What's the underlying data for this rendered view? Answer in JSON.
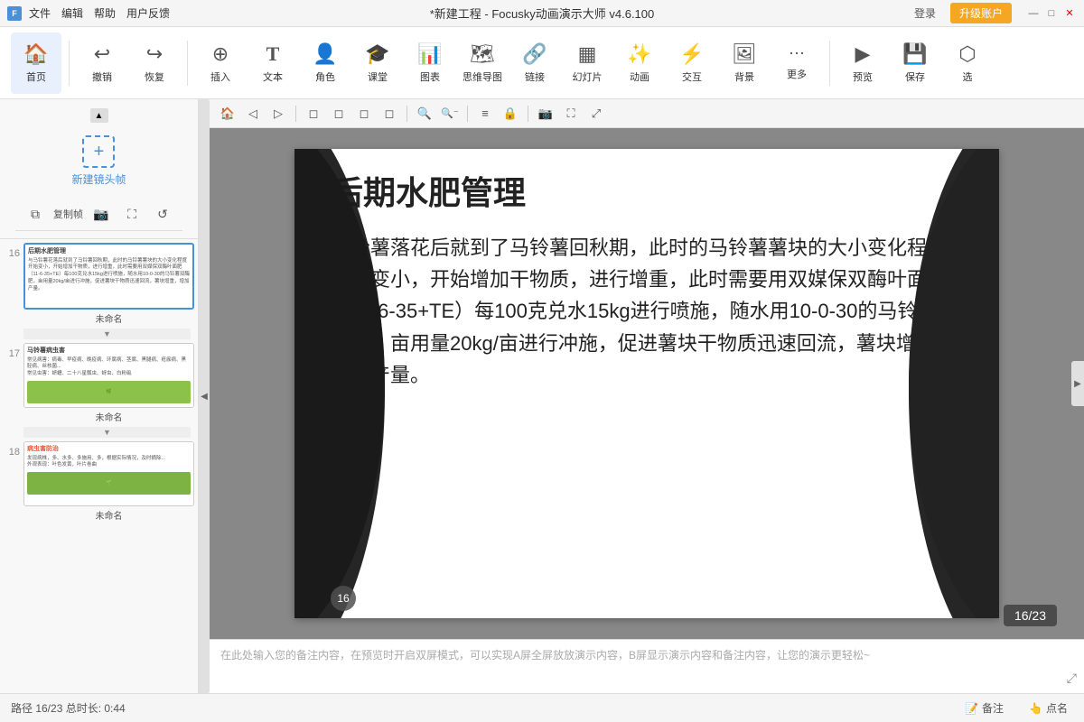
{
  "titlebar": {
    "logo": "F",
    "menu": [
      "文件",
      "编辑",
      "帮助",
      "用户反馈"
    ],
    "title": "*新建工程 - Focusky动画演示大师  v4.6.100",
    "login_label": "登录",
    "upgrade_label": "升级账户",
    "win_min": "—",
    "win_max": "□",
    "win_close": "✕"
  },
  "toolbar": {
    "items": [
      {
        "id": "home",
        "label": "首页",
        "icon": "🏠"
      },
      {
        "id": "undo",
        "label": "撤销",
        "icon": "↩"
      },
      {
        "id": "redo",
        "label": "恢复",
        "icon": "↪"
      },
      {
        "id": "insert",
        "label": "插入",
        "icon": "⊕"
      },
      {
        "id": "text",
        "label": "文本",
        "icon": "T"
      },
      {
        "id": "role",
        "label": "角色",
        "icon": "👤"
      },
      {
        "id": "classroom",
        "label": "课堂",
        "icon": "🎓"
      },
      {
        "id": "chart",
        "label": "图表",
        "icon": "📊"
      },
      {
        "id": "mindmap",
        "label": "思维导图",
        "icon": "🧠"
      },
      {
        "id": "link",
        "label": "链接",
        "icon": "🔗"
      },
      {
        "id": "slide",
        "label": "幻灯片",
        "icon": "▦"
      },
      {
        "id": "animate",
        "label": "动画",
        "icon": "✨"
      },
      {
        "id": "interact",
        "label": "交互",
        "icon": "⚡"
      },
      {
        "id": "bg",
        "label": "背景",
        "icon": "🖼"
      },
      {
        "id": "more",
        "label": "更多",
        "icon": "···"
      },
      {
        "id": "preview",
        "label": "预览",
        "icon": "▶"
      },
      {
        "id": "save",
        "label": "保存",
        "icon": "💾"
      },
      {
        "id": "select",
        "label": "选",
        "icon": "⬡"
      }
    ]
  },
  "sidebar": {
    "new_frame_label": "新建镜头帧",
    "tools": [
      "复制帧",
      "📷",
      "⛶",
      "↺"
    ],
    "slides": [
      {
        "num": 16,
        "active": true,
        "title": "后期水肥管理",
        "text": "与马铃薯花落后就到了马铃薯回秋期，此时的马铃薯薯块的大小变化程度开始变小，开始增加干物质，进行增重，此时需要用双媒保双酶叶面肥（11-6-35+TE）每100克兑水15kg进行喷施，随水用10-0-30的马铃薯双酶肥，亩用量20kg/亩进行冲施，促进薯块干物质迅速回流，薯块增重，增加产量。",
        "label": "未命名"
      },
      {
        "num": 17,
        "active": false,
        "title": "马铃薯病虫害",
        "text": "常见病害：病毒、早疫病、晚疫病、环腐病、茎腐、黑腿病、疮痂病、黑胫病、丝核菌...\n常见虫害：蛴螬、二十八星瓢虫、蚜虫、白粉虱",
        "label": "未命名",
        "has_image": true
      },
      {
        "num": 18,
        "active": false,
        "title": "病虫害防治",
        "text": "病害：发现病株，多、水多、多施用、多，根据实际情况，及时摘除...\n外观表现：叶色发黄，叶片卷曲，地下部分有虫害...",
        "label": "未命名",
        "has_image": true
      }
    ]
  },
  "canvas": {
    "toolbar_tools": [
      "🏠",
      "◁",
      "▷",
      "◻",
      "◻",
      "◻",
      "◻",
      "🔍+",
      "🔍-",
      "≡",
      "🔒",
      "📷",
      "□",
      "▱"
    ],
    "slide_title": "后期水肥管理",
    "slide_body": "马铃薯落花后就到了马铃薯回秋期，此时的马铃薯薯块的大小变化程度开始变小，开始增加干物质，进行增重，此时需要用双媒保双酶叶面肥（11-6-35+TE）每100克兑水15kg进行喷施，随水用10-0-30的马铃薯双酶肥，亩用量20kg/亩进行冲施，促进薯块干物质迅速回流，薯块增重，增加产量。",
    "slide_badge": "16",
    "page_counter": "16/23"
  },
  "notes": {
    "placeholder": "在此处输入您的备注内容，在预览时开启双屏模式，可以实现A屏全屏放放演示内容，B屏显示演示内容和备注内容，让您的演示更轻松~"
  },
  "statusbar": {
    "path_label": "路径 16/23  总时长: 0:44",
    "notes_label": "备注",
    "points_label": "点名"
  }
}
